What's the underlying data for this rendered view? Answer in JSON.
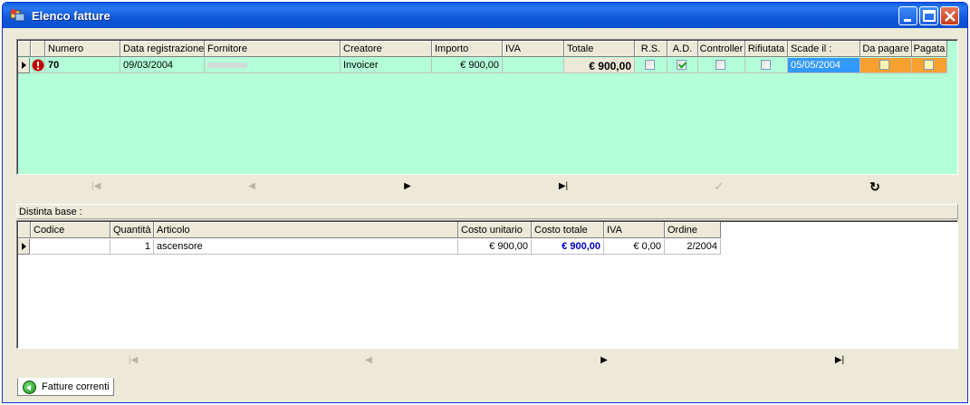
{
  "window": {
    "title": "Elenco fatture"
  },
  "invoices": {
    "columns": [
      "Numero",
      "Data registrazione",
      "Fornitore",
      "Creatore",
      "Importo",
      "IVA",
      "Totale",
      "R.S.",
      "A.D.",
      "Controller",
      "Rifiutata",
      "Scade il :",
      "Da pagare",
      "Pagata"
    ],
    "row": {
      "numero": "70",
      "data_registrazione": "09/03/2004",
      "fornitore": "",
      "creatore": "Invoicer",
      "importo": "€ 900,00",
      "iva": "",
      "totale": "€ 900,00",
      "rs": false,
      "ad": true,
      "controller": false,
      "rifiutata": false,
      "scade_il": "05/05/2004",
      "da_pagare": false,
      "pagata": false
    }
  },
  "bom": {
    "label": "Distinta base :",
    "columns": [
      "Codice",
      "Quantità",
      "Articolo",
      "Costo unitario",
      "Costo totale",
      "IVA",
      "Ordine"
    ],
    "row": {
      "codice": "",
      "quantita": "1",
      "articolo": "ascensore",
      "costo_unitario": "€ 900,00",
      "costo_totale": "€ 900,00",
      "iva": "€ 0,00",
      "ordine": "2/2004"
    }
  },
  "tab": {
    "label": "Fatture correnti"
  },
  "icons": [
    "app-icon",
    "minimize-icon",
    "maximize-icon",
    "close-icon",
    "warning-icon",
    "first-record-icon",
    "prior-record-icon",
    "next-record-icon",
    "last-record-icon",
    "post-icon",
    "refresh-icon",
    "tab-icon"
  ],
  "colors": {
    "grid_background": "#b3ffd9",
    "titlebar": "#0a5ede",
    "due_date_selected": "#3399ff",
    "status_orange": "#f7a030",
    "bom_total": "#0000c0"
  }
}
